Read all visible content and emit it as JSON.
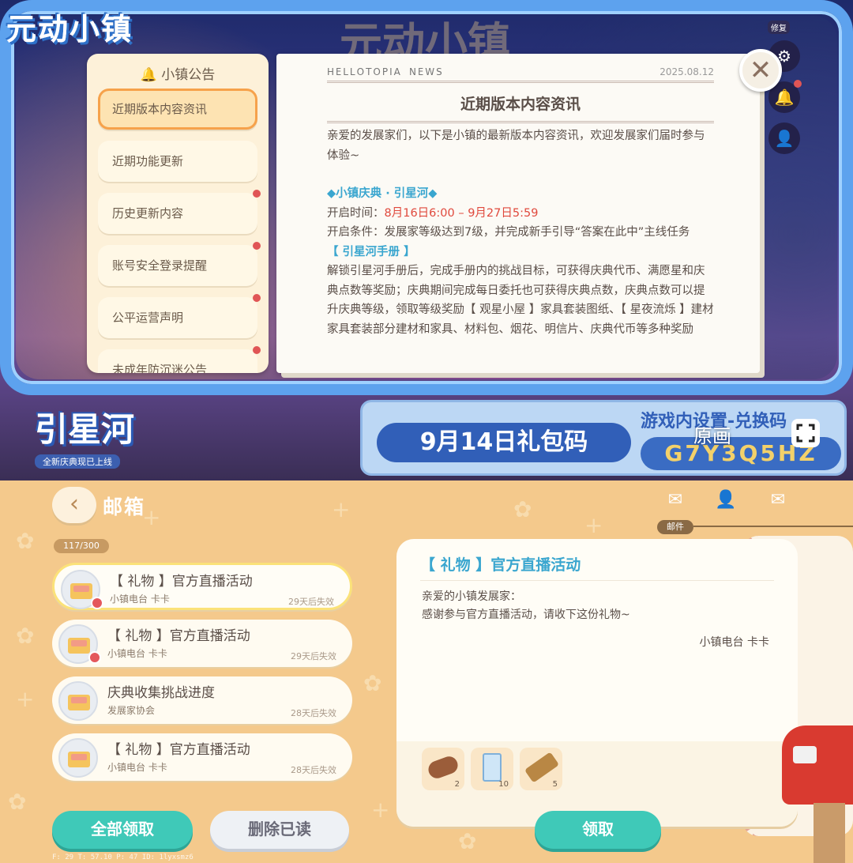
{
  "top": {
    "logo": "元动小镇",
    "bg_logo": "元动小镇",
    "repair_label": "修复",
    "notice_title": "小镇公告",
    "menu": [
      {
        "label": "近期版本内容资讯",
        "active": true,
        "dot": false
      },
      {
        "label": "近期功能更新",
        "active": false,
        "dot": false
      },
      {
        "label": "历史更新内容",
        "active": false,
        "dot": true
      },
      {
        "label": "账号安全登录提醒",
        "active": false,
        "dot": true
      },
      {
        "label": "公平运营声明",
        "active": false,
        "dot": true
      },
      {
        "label": "未成年防沉迷公告",
        "active": false,
        "dot": true
      }
    ],
    "paper": {
      "deco_header": "ꓧЕꓡꓡꓳꓔꓳꓑꓲꓮ ꓠЕꓪꓢ",
      "date": "2025.08.12",
      "title": "近期版本内容资讯",
      "intro": "亲爱的发展家们，以下是小镇的最新版本内容资讯，欢迎发展家们届时参与体验~",
      "section1": "◆小镇庆典 · 引星河◆",
      "time_label": "开启时间：",
      "time_value": "8月16日6:00 – 9月27日5:59",
      "condition": "开启条件：发展家等级达到7级，并完成新手引导“答案在此中”主线任务",
      "section2": "【 引星河手册 】",
      "detail": "解锁引星河手册后，完成手册内的挑战目标，可获得庆典代币、满愿星和庆典点数等奖励；庆典期间完成每日委托也可获得庆典点数，庆典点数可以提升庆典等级，领取等级奖励【 观星小屋 】家具套装图纸、【 星夜流烁 】建材家具套装部分建材和家具、材料包、烟花、明信片、庆典代币等多种奖励"
    },
    "close_symbol": "✕",
    "banner_left_title": "引星河",
    "banner_left_sub": "全新庆典现已上线",
    "banner_pill": "9月14日礼包码",
    "banner_sub": "游戏内设置-兑换码",
    "banner_code": "G7Y3Q5HZ",
    "yuanhua": "原画"
  },
  "bottom": {
    "back_symbol": "‹",
    "title": "邮箱",
    "tab_label": "邮件",
    "count": "117/300",
    "mails": [
      {
        "subject": "【 礼物 】官方直播活动",
        "sender": "小镇电台 卡卡",
        "expire": "29天后失效",
        "gift": true,
        "selected": true
      },
      {
        "subject": "【 礼物 】官方直播活动",
        "sender": "小镇电台 卡卡",
        "expire": "29天后失效",
        "gift": true,
        "selected": false
      },
      {
        "subject": "庆典收集挑战进度",
        "sender": "发展家协会",
        "expire": "28天后失效",
        "gift": false,
        "selected": false
      },
      {
        "subject": "【 礼物 】官方直播活动",
        "sender": "小镇电台 卡卡",
        "expire": "28天后失效",
        "gift": false,
        "selected": false
      }
    ],
    "claim_all": "全部领取",
    "delete_read": "删除已读",
    "detail": {
      "title": "【 礼物 】官方直播活动",
      "line1": "亲爱的小镇发展家：",
      "line2": "感谢参与官方直播活动，请收下这份礼物~",
      "sign": "小镇电台 卡卡",
      "attachments": [
        {
          "name": "wood-log",
          "qty": "2"
        },
        {
          "name": "milk-carton",
          "qty": "10"
        },
        {
          "name": "wood-plank",
          "qty": "5"
        }
      ]
    },
    "claim": "领取",
    "debug": "F: 29    T: 57.10    P: 47    ID: 1lyxsmz6"
  },
  "colors": {
    "accent_teal": "#3fc9b8",
    "title_blue": "#3aa6cf",
    "highlight_red": "#e0493d",
    "frame_blue": "#5da2ee",
    "background_orange": "#f4c98c"
  }
}
